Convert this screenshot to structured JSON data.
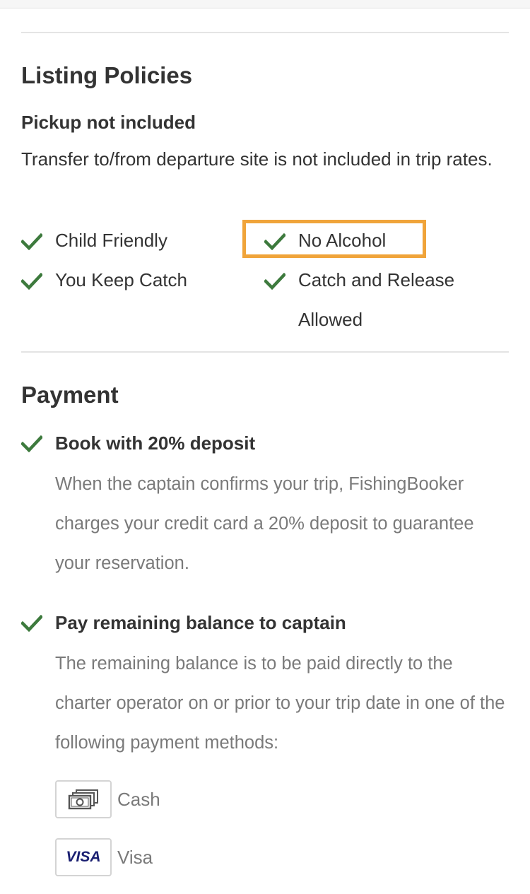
{
  "listing_policies": {
    "title": "Listing Policies",
    "pickup_title": "Pickup not included",
    "pickup_description": "Transfer to/from departure site is not included in trip rates.",
    "features": [
      {
        "label": "Child Friendly",
        "icon": "check-icon"
      },
      {
        "label": "No Alcohol",
        "icon": "check-icon",
        "highlighted": true
      },
      {
        "label": "You Keep Catch",
        "icon": "check-icon"
      },
      {
        "label": "Catch and Release Allowed",
        "icon": "check-icon"
      }
    ]
  },
  "payment": {
    "title": "Payment",
    "items": [
      {
        "title": "Book with 20% deposit",
        "description": "When the captain confirms your trip, FishingBooker charges your credit card a 20% deposit to guarantee your reservation."
      },
      {
        "title": "Pay remaining balance to captain",
        "description": "The remaining balance is to be paid directly to the charter operator on or prior to your trip date in one of the following payment methods:"
      }
    ],
    "methods": [
      {
        "label": "Cash",
        "icon": "cash-icon"
      },
      {
        "label": "Visa",
        "icon": "visa-icon",
        "logo_text": "VISA"
      }
    ]
  },
  "colors": {
    "check": "#3d7a3d",
    "highlight": "#f0a43a",
    "visa": "#1a1f71"
  }
}
